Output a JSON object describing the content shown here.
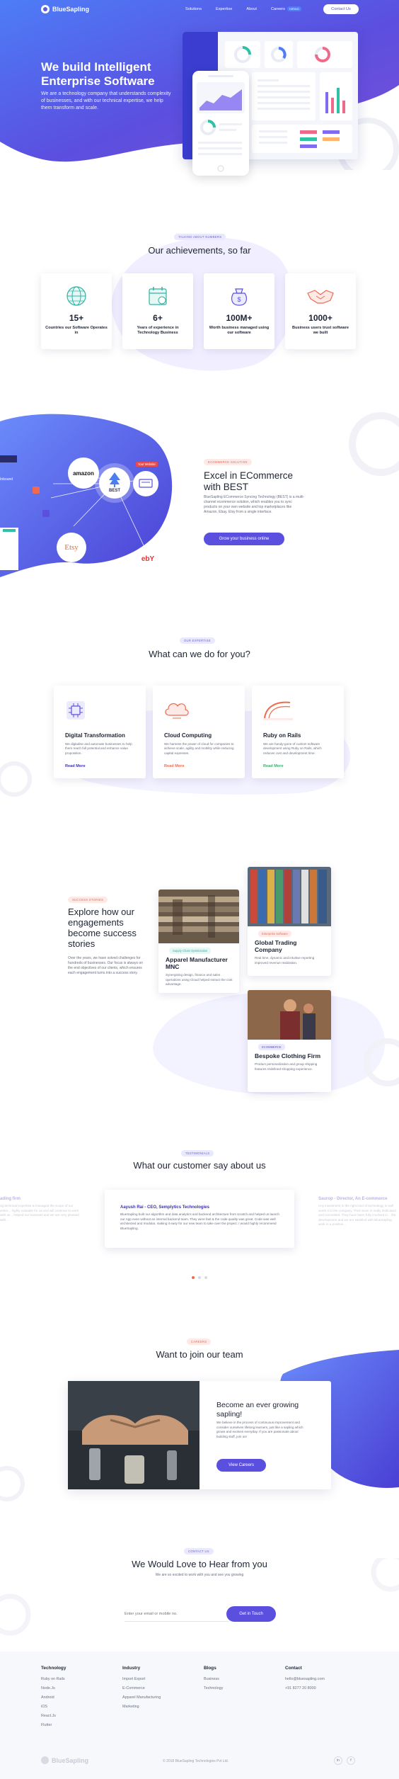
{
  "brand": {
    "name": "BlueSapling"
  },
  "nav": {
    "items": [
      "Solutions",
      "Expertise",
      "About",
      "Careers"
    ],
    "careers_badge": "HIRING",
    "contact_label": "Contact Us"
  },
  "hero": {
    "title_line1": "We build Intelligent",
    "title_line2": "Enterprise Software",
    "text": "We are a technology company that understands complexity of businesses, and with our technical expertise, we help them transform and scale."
  },
  "achievements": {
    "tag": "TALKING ABOUT NUMBERS",
    "title": "Our achievements, so far",
    "items": [
      {
        "value": "15+",
        "label": "Countries our Software Operates in",
        "icon": "globe-icon"
      },
      {
        "value": "6+",
        "label": "Years of experience in Technology Business",
        "icon": "calendar-icon"
      },
      {
        "value": "100M+",
        "label": "Worth business managed using our software",
        "icon": "money-bag-icon"
      },
      {
        "value": "1000+",
        "label": "Business users trust software we built",
        "icon": "handshake-icon"
      }
    ]
  },
  "ecommerce": {
    "tag": "ECOMMERCE SOLUTION",
    "title_line1": "Excel in ECommerce",
    "title_line2": "with BEST",
    "text": "BlueSapling ECommerce Syncing Technology (BEST) is a multi-channel ecommerce solution, which enables you to sync products on your own website and top marketplaces like Amazon, Ebay, Etsy from a single interface.",
    "button": "Grow your business online",
    "diagram": {
      "hub": "BEST",
      "nodes": [
        "amazon",
        "Your Website",
        "Etsy",
        "ebY"
      ],
      "left_label": "Inbound"
    }
  },
  "services": {
    "tag": "OUR EXPERTISE",
    "title": "What can we do for you?",
    "items": [
      {
        "title": "Digital Transformation",
        "text": "We digitalise and automate businesses to help them reach full potential and enhance value proposition.",
        "more": "Read More",
        "color": "#3a2fb8",
        "icon": "chip-icon"
      },
      {
        "title": "Cloud Computing",
        "text": "We harness the power of cloud for companies to achieve scale, agility and mobility while reducing capital expenses.",
        "more": "Read More",
        "color": "#ef6a4e",
        "icon": "cloud-icon"
      },
      {
        "title": "Ruby on Rails",
        "text": "We are handy-gone of custom software development using Ruby on Rails, which reduces cost and development time.",
        "more": "Read More",
        "color": "#2fb36b",
        "icon": "rails-icon"
      }
    ]
  },
  "stories": {
    "tag": "SUCCESS STORIES",
    "title_line1": "Explore how our",
    "title_line2": "engagements",
    "title_line3": "become success",
    "title_line4": "stories",
    "text": "Over the years, we have solved challenges for hundreds of businesses. Our focus is always on the end objectives of our clients, which ensures each engagement turns into a success story.",
    "cards": [
      {
        "tag": "Supply Chain Optimization",
        "title_line1": "Apparel Manufacturer",
        "title_line2": "MNC",
        "text": "Synergising design, finance and sales operations using Cloud helped extract the cost advantage."
      },
      {
        "tag": "Enterprise Software",
        "title_line1": "Global Trading",
        "title_line2": "Company",
        "text": "Real time, dynamic and intuitive reporting improved revenue realization."
      },
      {
        "tag": "ECOMMERCE",
        "title_line1": "Bespoke Clothing Firm",
        "title_line2": "",
        "text": "Product personalization and group shipping features redefined shopping experience."
      }
    ]
  },
  "testimonials": {
    "tag": "TESTIMONIALS",
    "title": "What our customer say about us",
    "main": {
      "name": "Aayush Rai - CEO, Semplytics Technologies",
      "text": "BlueSapling built our algorithm and data analytics and backend architecture from scratch and helped us launch our App even without an internal backend team. They were fast & the code quality was great. Code was well architected and modular, making it easy for our new team to take over the project. I would highly recommend BlueSapling."
    },
    "left": {
      "name": "ading firm",
      "text": "ng technical expertise & managed the scope of our entire... highly valuable for us and will continue to work with us... helped our business and we are very pleased with..."
    },
    "right": {
      "name": "Saurop - Director, An E-commerce",
      "text": "Any investment in the right kind of technology is well worth it to the company. Their team is really dedicated and committed. They have been fully involved in... the development and we are satisfied with BlueSapling work in a positive..."
    }
  },
  "join": {
    "tag": "CAREERS",
    "title": "Want to join our team",
    "card_title_line1": "Become an ever growing",
    "card_title_line2": "sapling!",
    "card_text": "We believe in the process of continuous improvement and consider ourselves lifelong learners, just like a sapling which grows and evolves everyday. If you are passionate about building stuff, join us!",
    "button": "View Careers"
  },
  "contact": {
    "tag": "CONTACT US",
    "title": "We Would Love to Hear from you",
    "subtitle": "We are so excited to work with you and see you growing",
    "placeholder": "Enter your email or mobile no.",
    "button": "Get in Touch"
  },
  "footer": {
    "columns": [
      {
        "head": "Technology",
        "items": [
          "Ruby on Rails",
          "Node.Js",
          "Android",
          "iOS",
          "React.Js",
          "Flutter"
        ]
      },
      {
        "head": "Industry",
        "items": [
          "Import Export",
          "E-Commerce",
          "Apparel Manufacturing",
          "Marketing"
        ]
      },
      {
        "head": "Blogs",
        "items": [
          "Business",
          "Technology"
        ]
      },
      {
        "head": "Contact",
        "items": [
          "hello@bluesapling.com",
          "+91 8277 20 8000"
        ]
      }
    ],
    "copyright": "© 2018 BlueSapling Technologies Pvt Ltd.",
    "social": [
      "in",
      "f"
    ]
  },
  "colors": {
    "primary": "#5b4fe0",
    "accent": "#4d7df7",
    "orange": "#ef6a4e",
    "green": "#2fb36b"
  }
}
